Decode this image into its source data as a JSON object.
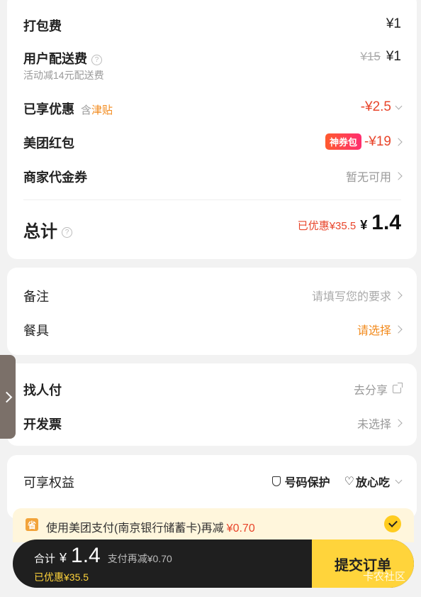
{
  "fees": {
    "packing": {
      "label": "打包费",
      "amount": "¥1"
    },
    "delivery": {
      "label": "用户配送费",
      "sub": "活动减14元配送费",
      "original": "¥15",
      "amount": "¥1"
    },
    "discount": {
      "label": "已享优惠",
      "tag_prefix": "含",
      "tag": "津贴",
      "amount": "-¥2.5"
    },
    "redpacket": {
      "label": "美团红包",
      "badge": "神券包",
      "amount": "-¥19"
    },
    "voucher": {
      "label": "商家代金券",
      "value": "暂无可用"
    },
    "total": {
      "label": "总计",
      "saved": "已优惠¥35.5",
      "currency": "¥",
      "amount": "1.4"
    }
  },
  "options": {
    "note": {
      "label": "备注",
      "placeholder": "请填写您的要求"
    },
    "cutlery": {
      "label": "餐具",
      "value": "请选择"
    }
  },
  "share": {
    "find_pay": {
      "label": "找人付",
      "value": "去分享"
    },
    "invoice": {
      "label": "开发票",
      "value": "未选择"
    }
  },
  "benefits": {
    "label": "可享权益",
    "protect": "号码保护",
    "safe": "放心吃"
  },
  "promo": {
    "icon_text": "省",
    "text": "使用美团支付(南京银行储蓄卡)再减",
    "amount": "¥0.70"
  },
  "bottom": {
    "total_label": "合计",
    "currency": "¥",
    "amount": "1.4",
    "extra": "支付再减¥0.70",
    "saved": "已优惠¥35.5",
    "submit": "提交订单"
  },
  "watermark": "卡农社区",
  "colors": {
    "accent_red": "#e8452b",
    "accent_orange": "#f28a1c",
    "submit_yellow": "#ffd43b",
    "bar_dark": "#1f1f1f"
  }
}
